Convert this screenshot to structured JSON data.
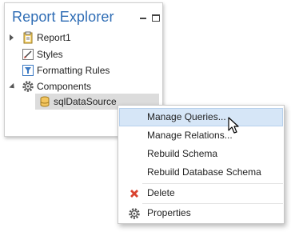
{
  "panel": {
    "title": "Report Explorer"
  },
  "tree": {
    "items": [
      {
        "label": "Report1",
        "icon": "report-icon"
      },
      {
        "label": "Styles",
        "icon": "styles-icon"
      },
      {
        "label": "Formatting Rules",
        "icon": "formatting-rules-icon"
      },
      {
        "label": "Components",
        "icon": "components-gear-icon"
      },
      {
        "label": "sqlDataSource",
        "icon": "database-icon"
      }
    ]
  },
  "context_menu": {
    "items": [
      {
        "label": "Manage Queries...",
        "hovered": true
      },
      {
        "label": "Manage Relations..."
      },
      {
        "label": "Rebuild Schema"
      },
      {
        "label": "Rebuild Database Schema"
      },
      {
        "label": "Delete",
        "icon": "delete-x-icon"
      },
      {
        "label": "Properties",
        "icon": "properties-gear-icon"
      }
    ]
  },
  "colors": {
    "title": "#2f6db5",
    "hover": "#d6e6f7",
    "selection": "#dcdcdc",
    "delete": "#d9432f"
  }
}
